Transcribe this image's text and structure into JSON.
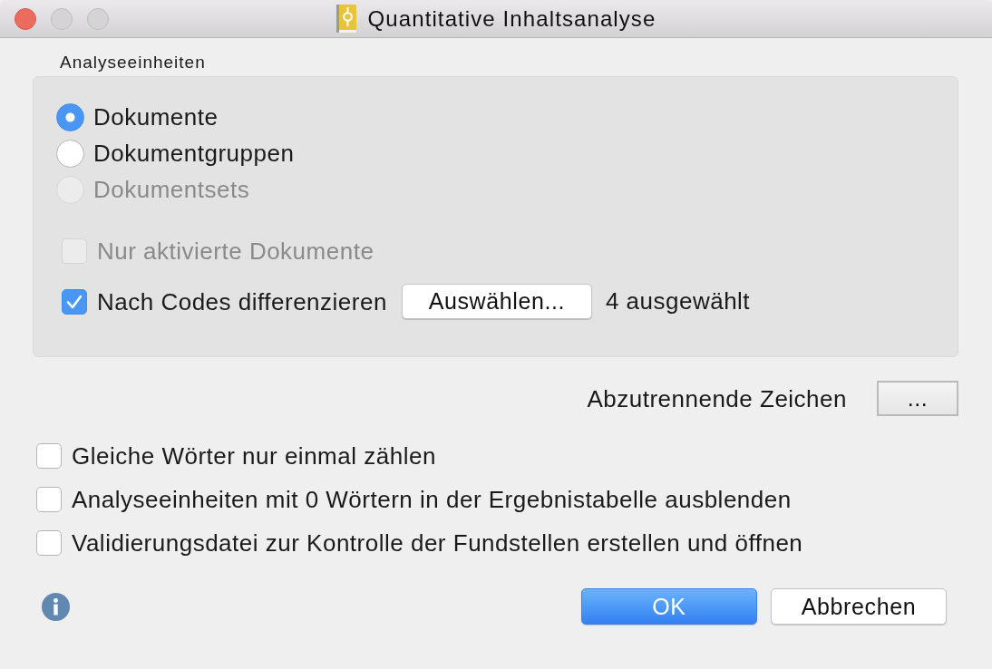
{
  "window": {
    "title": "Quantitative Inhaltsanalyse"
  },
  "analysis_units": {
    "label": "Analyseeinheiten",
    "options": [
      {
        "label": "Dokumente",
        "selected": true,
        "disabled": false
      },
      {
        "label": "Dokumentgruppen",
        "selected": false,
        "disabled": false
      },
      {
        "label": "Dokumentsets",
        "selected": false,
        "disabled": true
      }
    ],
    "only_activated": {
      "label": "Nur aktivierte Dokumente",
      "checked": false,
      "disabled": true
    },
    "differentiate_by_codes": {
      "label": "Nach Codes differenzieren",
      "checked": true,
      "disabled": false,
      "button": "Auswählen...",
      "status": "4 ausgewählt"
    }
  },
  "separator_chars": {
    "label": "Abzutrennende Zeichen",
    "button": "..."
  },
  "options": [
    {
      "label": "Gleiche Wörter nur einmal zählen",
      "checked": false
    },
    {
      "label": "Analyseeinheiten mit 0 Wörtern in der Ergebnistabelle ausblenden",
      "checked": false
    },
    {
      "label": "Validierungsdatei zur Kontrolle der Fundstellen erstellen und öffnen",
      "checked": false
    }
  ],
  "buttons": [
    {
      "label": "OK",
      "default": true
    },
    {
      "label": "Abbrechen",
      "default": false
    }
  ]
}
